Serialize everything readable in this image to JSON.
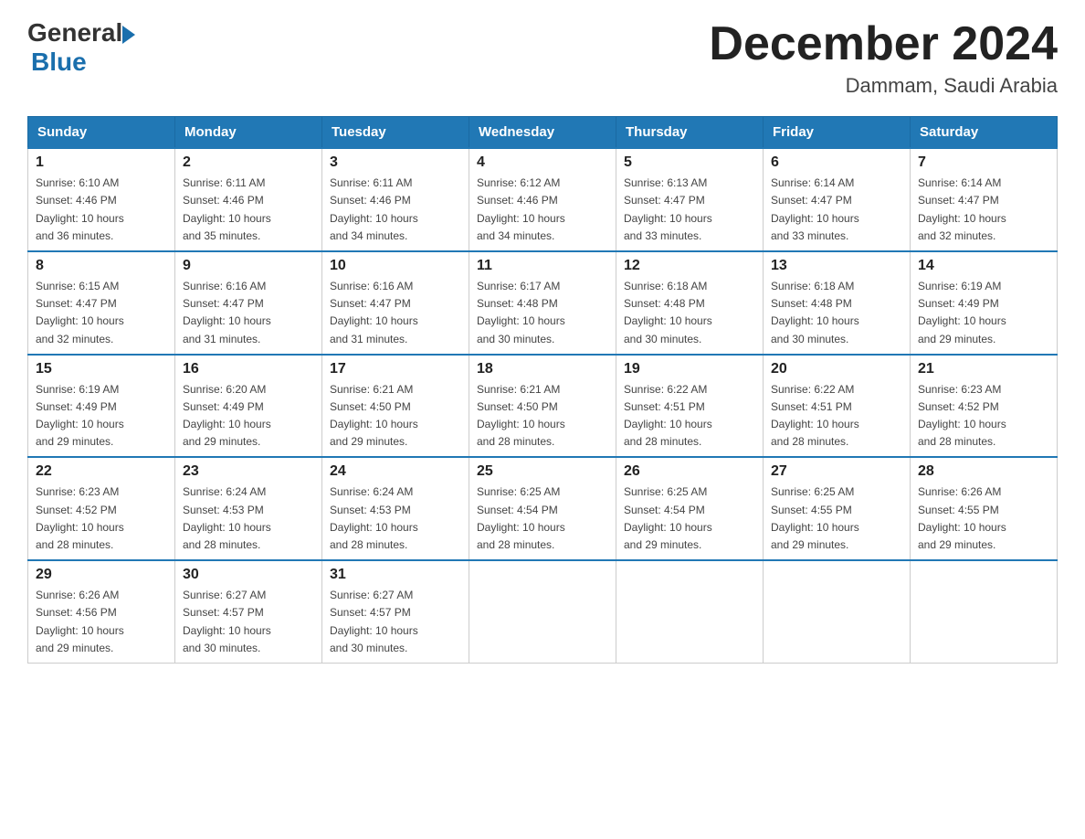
{
  "header": {
    "logo_general": "General",
    "logo_blue": "Blue",
    "title": "December 2024",
    "subtitle": "Dammam, Saudi Arabia"
  },
  "calendar": {
    "days_of_week": [
      "Sunday",
      "Monday",
      "Tuesday",
      "Wednesday",
      "Thursday",
      "Friday",
      "Saturday"
    ],
    "weeks": [
      [
        {
          "day": "1",
          "sunrise": "6:10 AM",
          "sunset": "4:46 PM",
          "daylight": "10 hours and 36 minutes."
        },
        {
          "day": "2",
          "sunrise": "6:11 AM",
          "sunset": "4:46 PM",
          "daylight": "10 hours and 35 minutes."
        },
        {
          "day": "3",
          "sunrise": "6:11 AM",
          "sunset": "4:46 PM",
          "daylight": "10 hours and 34 minutes."
        },
        {
          "day": "4",
          "sunrise": "6:12 AM",
          "sunset": "4:46 PM",
          "daylight": "10 hours and 34 minutes."
        },
        {
          "day": "5",
          "sunrise": "6:13 AM",
          "sunset": "4:47 PM",
          "daylight": "10 hours and 33 minutes."
        },
        {
          "day": "6",
          "sunrise": "6:14 AM",
          "sunset": "4:47 PM",
          "daylight": "10 hours and 33 minutes."
        },
        {
          "day": "7",
          "sunrise": "6:14 AM",
          "sunset": "4:47 PM",
          "daylight": "10 hours and 32 minutes."
        }
      ],
      [
        {
          "day": "8",
          "sunrise": "6:15 AM",
          "sunset": "4:47 PM",
          "daylight": "10 hours and 32 minutes."
        },
        {
          "day": "9",
          "sunrise": "6:16 AM",
          "sunset": "4:47 PM",
          "daylight": "10 hours and 31 minutes."
        },
        {
          "day": "10",
          "sunrise": "6:16 AM",
          "sunset": "4:47 PM",
          "daylight": "10 hours and 31 minutes."
        },
        {
          "day": "11",
          "sunrise": "6:17 AM",
          "sunset": "4:48 PM",
          "daylight": "10 hours and 30 minutes."
        },
        {
          "day": "12",
          "sunrise": "6:18 AM",
          "sunset": "4:48 PM",
          "daylight": "10 hours and 30 minutes."
        },
        {
          "day": "13",
          "sunrise": "6:18 AM",
          "sunset": "4:48 PM",
          "daylight": "10 hours and 30 minutes."
        },
        {
          "day": "14",
          "sunrise": "6:19 AM",
          "sunset": "4:49 PM",
          "daylight": "10 hours and 29 minutes."
        }
      ],
      [
        {
          "day": "15",
          "sunrise": "6:19 AM",
          "sunset": "4:49 PM",
          "daylight": "10 hours and 29 minutes."
        },
        {
          "day": "16",
          "sunrise": "6:20 AM",
          "sunset": "4:49 PM",
          "daylight": "10 hours and 29 minutes."
        },
        {
          "day": "17",
          "sunrise": "6:21 AM",
          "sunset": "4:50 PM",
          "daylight": "10 hours and 29 minutes."
        },
        {
          "day": "18",
          "sunrise": "6:21 AM",
          "sunset": "4:50 PM",
          "daylight": "10 hours and 28 minutes."
        },
        {
          "day": "19",
          "sunrise": "6:22 AM",
          "sunset": "4:51 PM",
          "daylight": "10 hours and 28 minutes."
        },
        {
          "day": "20",
          "sunrise": "6:22 AM",
          "sunset": "4:51 PM",
          "daylight": "10 hours and 28 minutes."
        },
        {
          "day": "21",
          "sunrise": "6:23 AM",
          "sunset": "4:52 PM",
          "daylight": "10 hours and 28 minutes."
        }
      ],
      [
        {
          "day": "22",
          "sunrise": "6:23 AM",
          "sunset": "4:52 PM",
          "daylight": "10 hours and 28 minutes."
        },
        {
          "day": "23",
          "sunrise": "6:24 AM",
          "sunset": "4:53 PM",
          "daylight": "10 hours and 28 minutes."
        },
        {
          "day": "24",
          "sunrise": "6:24 AM",
          "sunset": "4:53 PM",
          "daylight": "10 hours and 28 minutes."
        },
        {
          "day": "25",
          "sunrise": "6:25 AM",
          "sunset": "4:54 PM",
          "daylight": "10 hours and 28 minutes."
        },
        {
          "day": "26",
          "sunrise": "6:25 AM",
          "sunset": "4:54 PM",
          "daylight": "10 hours and 29 minutes."
        },
        {
          "day": "27",
          "sunrise": "6:25 AM",
          "sunset": "4:55 PM",
          "daylight": "10 hours and 29 minutes."
        },
        {
          "day": "28",
          "sunrise": "6:26 AM",
          "sunset": "4:55 PM",
          "daylight": "10 hours and 29 minutes."
        }
      ],
      [
        {
          "day": "29",
          "sunrise": "6:26 AM",
          "sunset": "4:56 PM",
          "daylight": "10 hours and 29 minutes."
        },
        {
          "day": "30",
          "sunrise": "6:27 AM",
          "sunset": "4:57 PM",
          "daylight": "10 hours and 30 minutes."
        },
        {
          "day": "31",
          "sunrise": "6:27 AM",
          "sunset": "4:57 PM",
          "daylight": "10 hours and 30 minutes."
        },
        null,
        null,
        null,
        null
      ]
    ],
    "labels": {
      "sunrise": "Sunrise:",
      "sunset": "Sunset:",
      "daylight": "Daylight:"
    }
  }
}
